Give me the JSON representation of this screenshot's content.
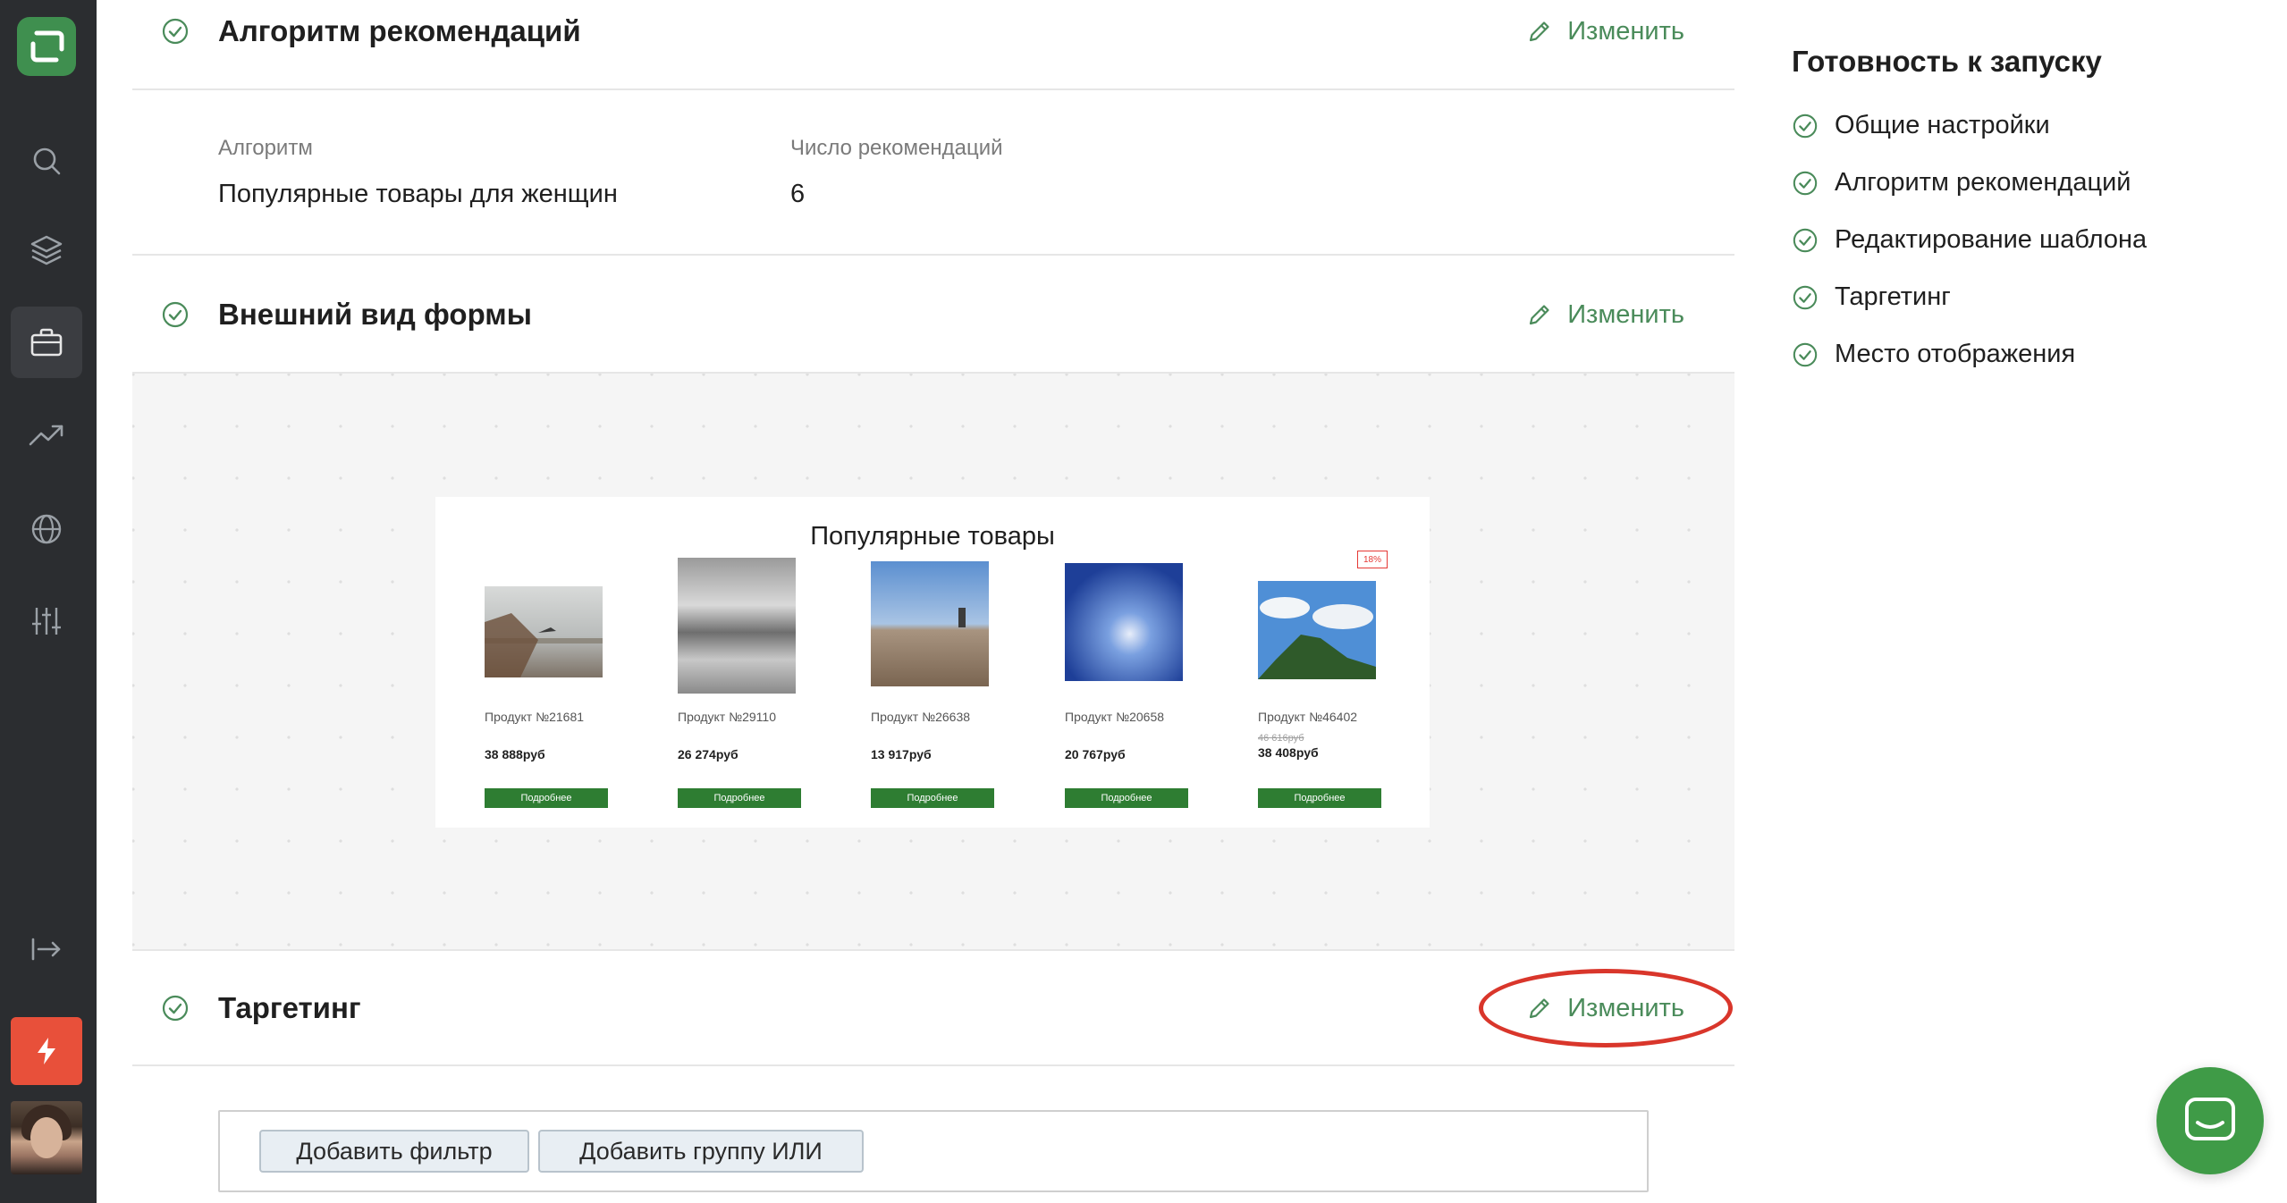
{
  "sidebar": {
    "items": [
      {
        "name": "search-icon"
      },
      {
        "name": "layers-icon"
      },
      {
        "name": "briefcase-icon",
        "active": true
      },
      {
        "name": "trending-up-icon"
      },
      {
        "name": "globe-icon"
      },
      {
        "name": "sliders-icon"
      }
    ],
    "bottom": [
      {
        "name": "logout-icon"
      },
      {
        "name": "flash-icon",
        "color": "#e8503a"
      }
    ]
  },
  "sections": {
    "algorithm": {
      "title": "Алгоритм рекомендаций",
      "edit_label": "Изменить",
      "algo_label": "Алгоритм",
      "algo_value": "Популярные товары для женщин",
      "count_label": "Число рекомендаций",
      "count_value": "6"
    },
    "appearance": {
      "title": "Внешний вид формы",
      "edit_label": "Изменить"
    },
    "targeting": {
      "title": "Таргетинг",
      "edit_label": "Изменить"
    }
  },
  "preview": {
    "title": "Популярные товары",
    "products": [
      {
        "name": "Продукт №21681",
        "price": "38 888руб",
        "button": "Подробнее"
      },
      {
        "name": "Продукт №29110",
        "price": "26 274руб",
        "button": "Подробнее"
      },
      {
        "name": "Продукт №26638",
        "price": "13 917руб",
        "button": "Подробнее"
      },
      {
        "name": "Продукт №20658",
        "price": "20 767руб",
        "button": "Подробнее"
      },
      {
        "name": "Продукт №46402",
        "old_price": "46 616руб",
        "price": "38 408руб",
        "button": "Подробнее",
        "badge": "18%"
      }
    ]
  },
  "filters": {
    "add_filter": "Добавить фильтр",
    "add_or_group": "Добавить группу ИЛИ"
  },
  "readiness": {
    "title": "Готовность к запуску",
    "items": [
      "Общие настройки",
      "Алгоритм рекомендаций",
      "Редактирование шаблона",
      "Таргетинг",
      "Место отображения"
    ]
  },
  "colors": {
    "accent": "#4a8b5a",
    "sidebar": "#2b2d30",
    "highlight": "#d9362b",
    "chat": "#3f9b47"
  }
}
